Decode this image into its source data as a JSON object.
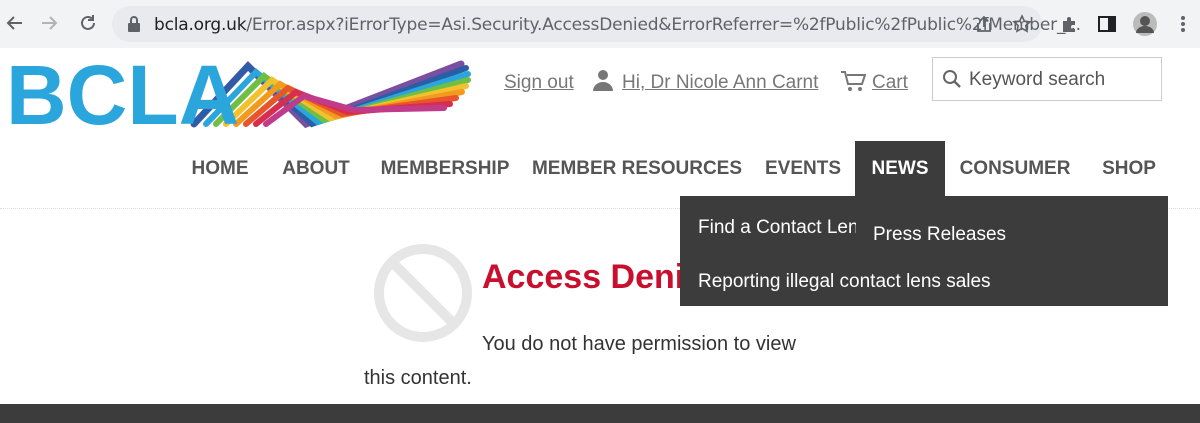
{
  "browser": {
    "url_host": "bcla.org.uk",
    "url_path": "/Error.aspx?iErrorType=Asi.Security.AccessDenied&ErrorReferrer=%2fPublic%2fPublic%2fMember_..."
  },
  "header": {
    "logo_text": "BCLA",
    "sign_out": "Sign out",
    "greeting": "Hi, Dr Nicole Ann Carnt",
    "cart": "Cart",
    "search_placeholder": "Keyword search"
  },
  "nav": {
    "items": [
      {
        "label": "HOME"
      },
      {
        "label": "ABOUT"
      },
      {
        "label": "MEMBERSHIP"
      },
      {
        "label": "MEMBER RESOURCES"
      },
      {
        "label": "EVENTS"
      },
      {
        "label": "NEWS"
      },
      {
        "label": "CONSUMER"
      },
      {
        "label": "SHOP"
      }
    ],
    "active": "NEWS"
  },
  "dropdown": {
    "items": [
      {
        "label": "Find a Contact Lens"
      },
      {
        "label": "Press Releases"
      },
      {
        "label": "Reporting illegal contact lens sales"
      }
    ]
  },
  "content": {
    "title": "Access Deni",
    "message_line1": "You do not have permission to view",
    "message_line2": "this content."
  },
  "colors": {
    "logo_blue": "#2aa6dc",
    "title_red": "#c8102e",
    "nav_active_bg": "#3c3c3c"
  }
}
